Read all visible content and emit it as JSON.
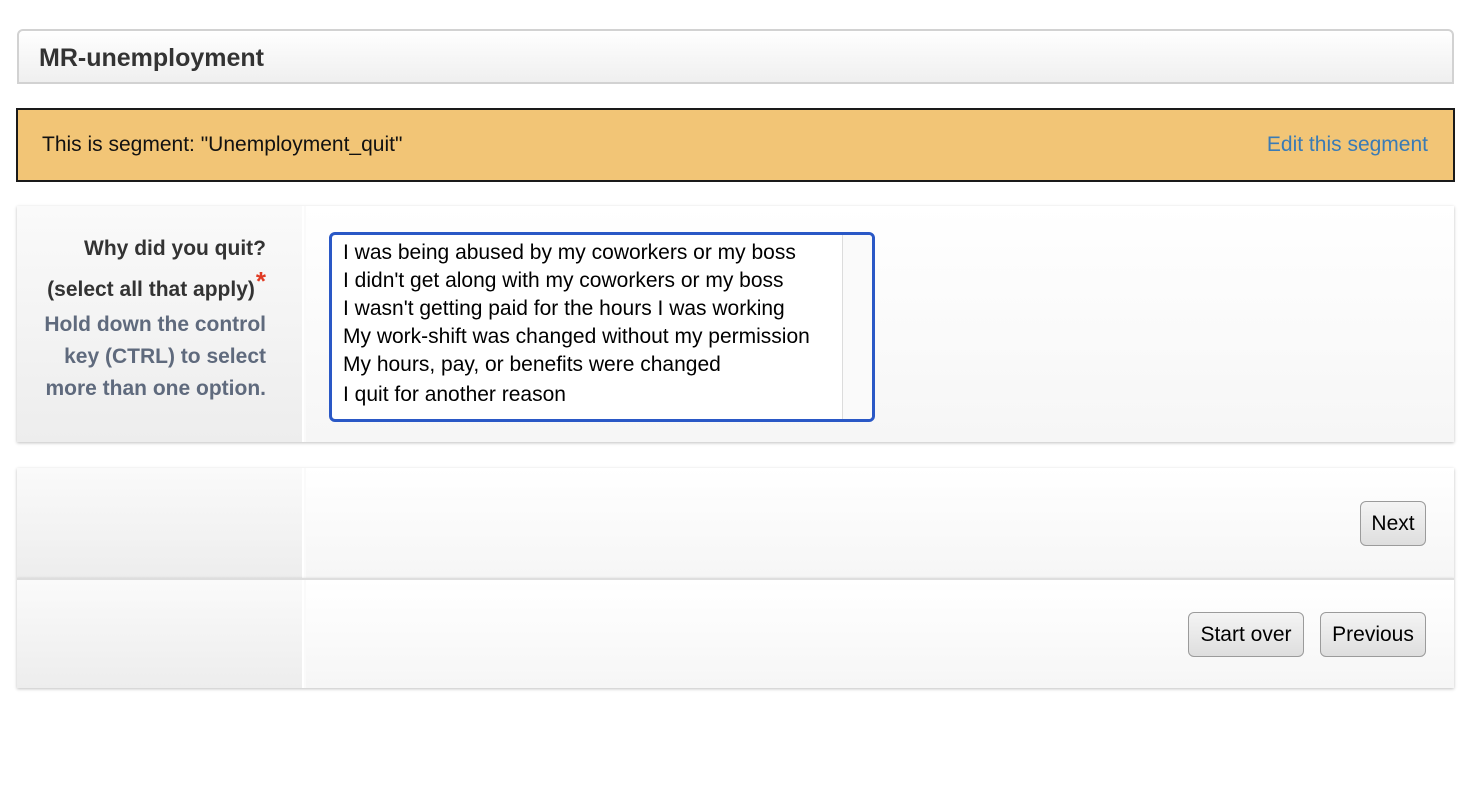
{
  "header": {
    "title": "MR-unemployment"
  },
  "segment": {
    "text": "This is segment: \"Unemployment_quit\"",
    "edit_link": "Edit this segment"
  },
  "question": {
    "label": "Why did you quit?",
    "label_sub": "(select all that apply)",
    "required_mark": "*",
    "hint": "Hold down the control key (CTRL) to select more than one option.",
    "options": [
      "I was being abused by my coworkers or my boss",
      "I didn't get along with my coworkers or my boss",
      "I wasn't getting paid for the hours I was working",
      "My work-shift was changed without my permission",
      "My hours, pay, or benefits were changed",
      "I quit for another reason"
    ]
  },
  "navigation": {
    "next_label": "Next",
    "start_over_label": "Start over",
    "previous_label": "Previous"
  },
  "colors": {
    "banner_background": "#f2c576",
    "link": "#3a7bb5",
    "select_focus": "#2a58c6",
    "required": "#e03b24",
    "hint_text": "#5f6a7d"
  }
}
